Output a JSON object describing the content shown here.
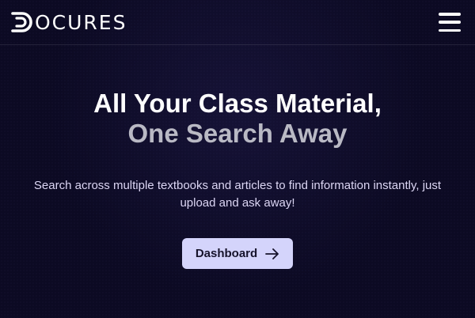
{
  "brand": {
    "name": "OCURES",
    "logo_icon": "d-letter-logo-icon"
  },
  "nav": {
    "menu_icon": "hamburger-menu-icon"
  },
  "hero": {
    "headline_line1": "All Your Class Material,",
    "headline_line2": "One Search Away",
    "subtitle": "Search across multiple textbooks and articles to find information instantly, just upload and ask away!",
    "cta_label": "Dashboard",
    "cta_icon": "arrow-right-icon"
  },
  "colors": {
    "background": "#0c0a23",
    "headline_primary": "#ffffff",
    "headline_secondary": "#b9b9c4",
    "subtitle": "#dcd6f4",
    "button_bg": "#d4d4fb",
    "button_text": "#16132b"
  }
}
